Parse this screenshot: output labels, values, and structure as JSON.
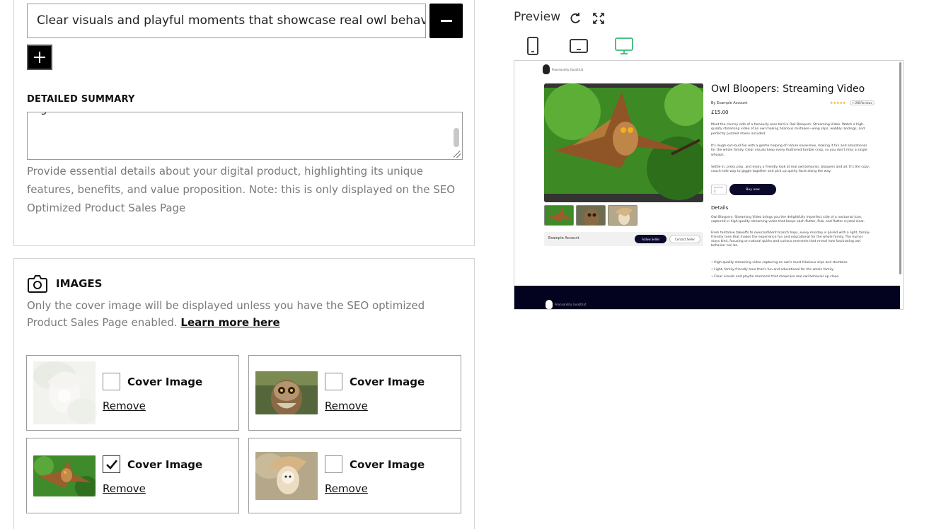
{
  "bullet": {
    "value": "Clear visuals and playful moments that showcase real owl behavior up close.",
    "remove_label": "Remove bullet",
    "add_label": "Add bullet"
  },
  "summary": {
    "label": "DETAILED SUMMARY",
    "visible_text": "g",
    "helper": "Provide essential details about your digital product, highlighting its unique features, benefits, and value proposition. Note: this is only displayed on the SEO Optimized Product Sales Page"
  },
  "images": {
    "title": "IMAGES",
    "helper": "Only the cover image will be displayed unless you have the SEO optimized Product Sales Page enabled.",
    "link": "Learn more here",
    "cards": [
      {
        "cover_label": "Cover Image",
        "remove_label": "Remove",
        "checked": false,
        "faded": true
      },
      {
        "cover_label": "Cover Image",
        "remove_label": "Remove",
        "checked": false,
        "faded": false
      },
      {
        "cover_label": "Cover Image",
        "remove_label": "Remove",
        "checked": true,
        "faded": false
      },
      {
        "cover_label": "Cover Image",
        "remove_label": "Remove",
        "checked": false,
        "faded": false
      }
    ]
  },
  "preview": {
    "title": "Preview",
    "active_device": "desktop",
    "accent_color": "#3cb878",
    "page": {
      "logo_text": "Peaceandity Goodthat",
      "product_title": "Owl Bloopers: Streaming Video",
      "by_line": "By Example Account",
      "stars": "★★★★★",
      "reviews": "+198 Reviews",
      "price": "£15.00",
      "desc_1": "Meet the clumsy side of a famously wise bird in Owl Bloopers: Streaming Video. Watch a high-quality streaming video of an owl making hilarious mistakes—wing slips, wobbly landings, and perfectly puzzled stares included.",
      "desc_2": "It's laugh-out-loud fun with a gentle helping of nature know-how, making it fun and educational for the whole family. Clear visuals keep every feathered fumble crisp, so you don't miss a single whoops.",
      "desc_3": "Settle in, press play, and enjoy a friendly look at real owl behavior, bloopers and all. It's the cozy, couch-side way to giggle together and pick up quirky facts along the way.",
      "quantity_label": "Quantity",
      "quantity_value": "1",
      "buy_label": "Buy now",
      "details_title": "Details",
      "details_1": "Owl Bloopers: Streaming Video brings you the delightfully imperfect side of a nocturnal icon, captured in high-quality streaming video that keeps each flutter, flub, and flutter crystal clear.",
      "details_2": "From tentative takeoffs to overconfident branch hops, every misstep is paired with a light, family-friendly tone that makes the experience fun and educational for the whole family. The humor stays kind, focusing on natural quirks and curious moments that reveal how fascinating owl behavior can be.",
      "bullets": [
        "• High-quality streaming video capturing an owl's most hilarious slips and stumbles.",
        "• Light, family-friendly tone that's fun and educational for the whole family.",
        "• Clear visuals and playful moments that showcase real owl behavior up close."
      ],
      "seller_name": "Example Account",
      "follow_label": "Follow Seller",
      "contact_label": "Contact Seller"
    }
  }
}
